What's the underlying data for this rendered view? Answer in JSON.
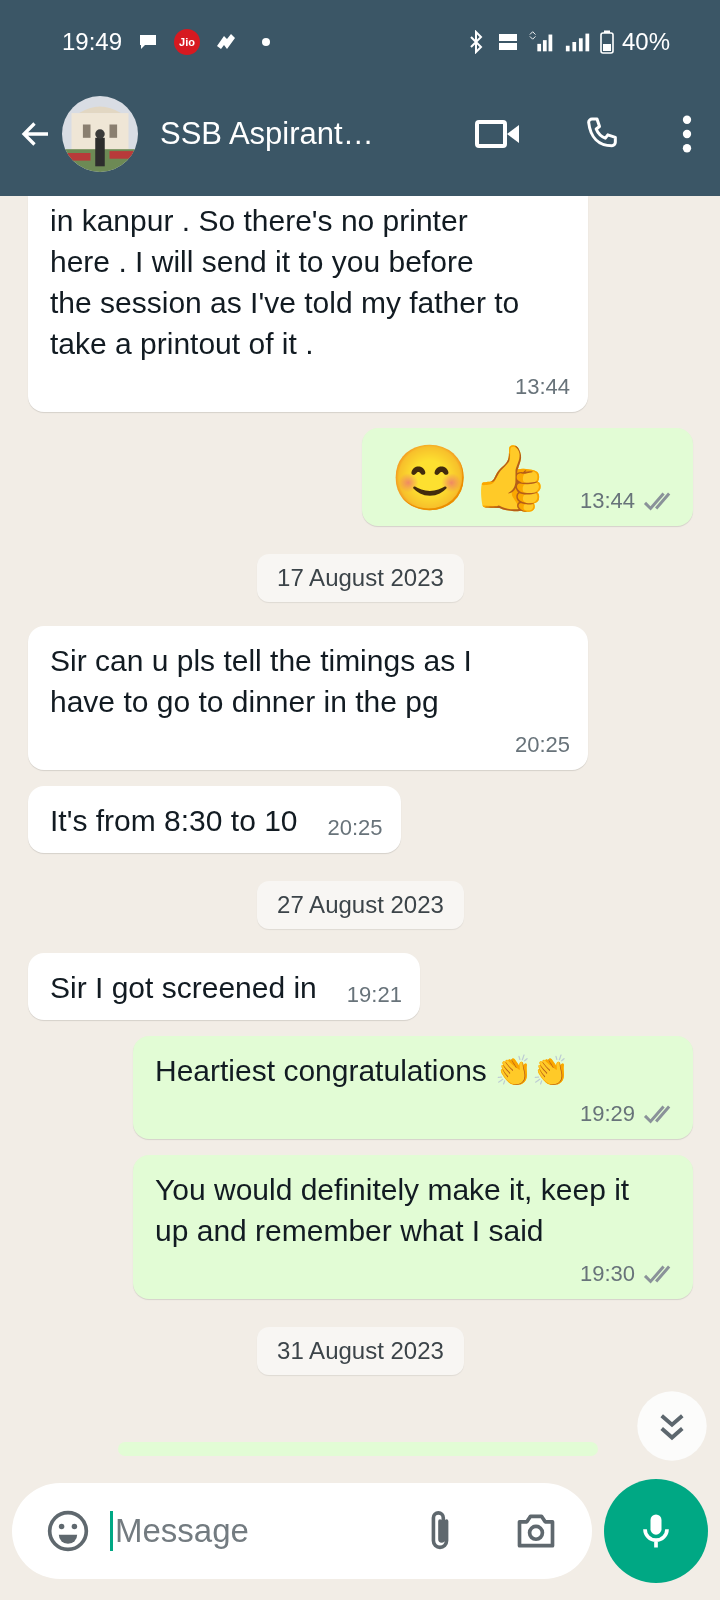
{
  "status_bar": {
    "time": "19:49",
    "carrier_badge": "Jio",
    "battery": "40%"
  },
  "header": {
    "title": "SSB Aspirant…"
  },
  "messages": [
    {
      "kind": "in",
      "text": "in kanpur . So there's no printer here . I will send it to you before the session as I've told my father to take a printout of it .",
      "time": "13:44"
    },
    {
      "kind": "out",
      "text": "😊👍",
      "emoji_only": true,
      "time": "13:44",
      "read": false
    },
    {
      "kind": "date",
      "text": "17 August 2023"
    },
    {
      "kind": "in",
      "text": "Sir can u pls tell the timings as I have to go to dinner in the pg",
      "time": "20:25"
    },
    {
      "kind": "in",
      "text": "It's from 8:30 to 10",
      "time": "20:25"
    },
    {
      "kind": "date",
      "text": "27 August 2023"
    },
    {
      "kind": "in",
      "text": "Sir I got screened in",
      "time": "19:21"
    },
    {
      "kind": "out",
      "text": "Heartiest congratulations 👏👏",
      "time": "19:29",
      "read": false
    },
    {
      "kind": "out",
      "text": "You would definitely make it, keep it up and remember what I said",
      "time": "19:30",
      "read": false
    },
    {
      "kind": "date",
      "text": "31 August 2023"
    }
  ],
  "composer": {
    "placeholder": "Message"
  }
}
